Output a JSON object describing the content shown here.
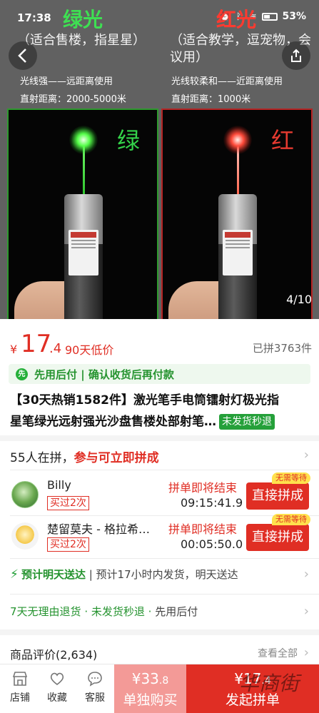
{
  "status": {
    "time": "17:38",
    "battery": "53%"
  },
  "hero": {
    "green": {
      "title": "绿光",
      "subtitle": "（适合售楼，指星星）",
      "desc1": "光线强——远距离使用",
      "desc2": "直射距离：2000-5000米",
      "label": "绿"
    },
    "red": {
      "title": "红光",
      "subtitle": "（适合教学，逗宠物，会议用）",
      "desc1": "光线较柔和——近距离使用",
      "desc2": "直射距离：1000米",
      "label": "红"
    },
    "photo_counter": "4/10"
  },
  "price": {
    "symbol": "¥",
    "integer": "17",
    "decimal": ".4",
    "tag": "90天低价",
    "sold": "已拼3763件"
  },
  "pay_later": {
    "icon": "先",
    "text": "先用后付 | 确认收货后再付款"
  },
  "product": {
    "title_line1": "【30天热销1582件】激光笔手电筒镭射灯极光指",
    "title_line2": "星笔绿光远射强光沙盘售楼处部射笔…",
    "badge": "未发货秒退"
  },
  "group": {
    "count_text": "55人在拼，",
    "cta": "参与可立即拼成",
    "rows": [
      {
        "name": "Billy",
        "bought": "买过2次",
        "ending": "拼单即将结束",
        "countdown": "09:15:41.9",
        "button": "直接拼成",
        "nowait": "无需等待"
      },
      {
        "name": "楚留莫夫 - 格拉希…",
        "bought": "买过2次",
        "ending": "拼单即将结束",
        "countdown": "00:05:50.0",
        "button": "直接拼成",
        "nowait": "无需等待"
      }
    ]
  },
  "shipping": {
    "highlight": "预计明天送达",
    "rest": "预计17小时内发货，明天送达"
  },
  "services": {
    "a": "7天无理由退货",
    "b": "未发货秒退",
    "c": "先用后付",
    "sep": " · "
  },
  "reviews": {
    "title": "商品评价(2,634)",
    "more": "查看全部"
  },
  "bottom": {
    "tabs": [
      "店铺",
      "收藏",
      "客服"
    ],
    "solo": {
      "symbol": "¥",
      "price": "33",
      "decimal": ".8",
      "label": "单独购买"
    },
    "group": {
      "symbol": "¥",
      "price": "17",
      "decimal": ".4",
      "label": "发起拼单"
    }
  },
  "watermark": "华商街",
  "colors": {
    "accent": "#e02e24",
    "green": "#25932f"
  }
}
